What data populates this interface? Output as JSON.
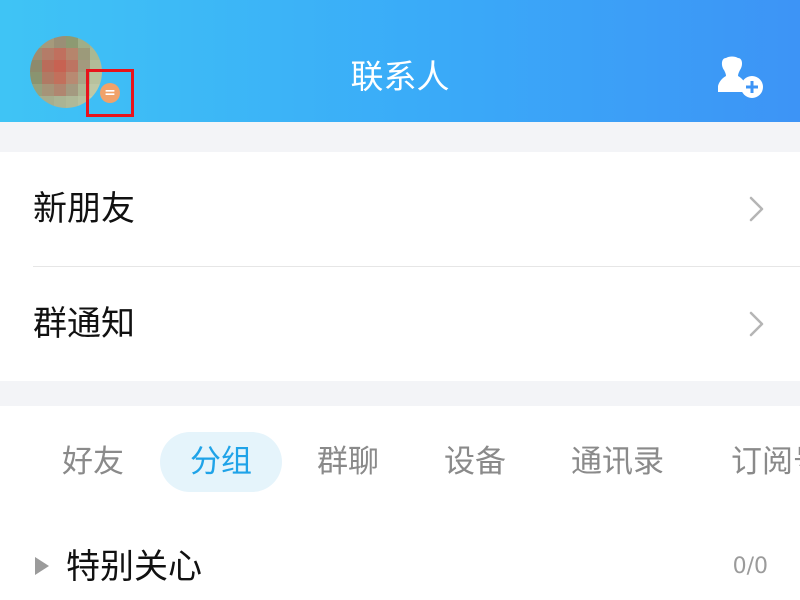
{
  "header": {
    "title": "联系人",
    "status_indicator": "=",
    "add_contact_icon": "add-contact-icon",
    "avatar_icon": "user-avatar"
  },
  "list": {
    "items": [
      {
        "label": "新朋友",
        "icon": "chevron-right-icon"
      },
      {
        "label": "群通知",
        "icon": "chevron-right-icon"
      }
    ]
  },
  "tabs": [
    {
      "label": "好友",
      "active": false
    },
    {
      "label": "分组",
      "active": true
    },
    {
      "label": "群聊",
      "active": false
    },
    {
      "label": "设备",
      "active": false
    },
    {
      "label": "通讯录",
      "active": false
    },
    {
      "label": "订阅号",
      "active": false
    }
  ],
  "group": {
    "name": "特别关心",
    "count": "0/0",
    "expanded": false
  },
  "colors": {
    "header_start": "#3fc4f5",
    "header_end": "#3d94f6",
    "accent": "#1fa3e8",
    "active_tab_bg": "#e5f4fb",
    "highlight_box": "#e8131b",
    "status_dot": "#f0a26a"
  }
}
